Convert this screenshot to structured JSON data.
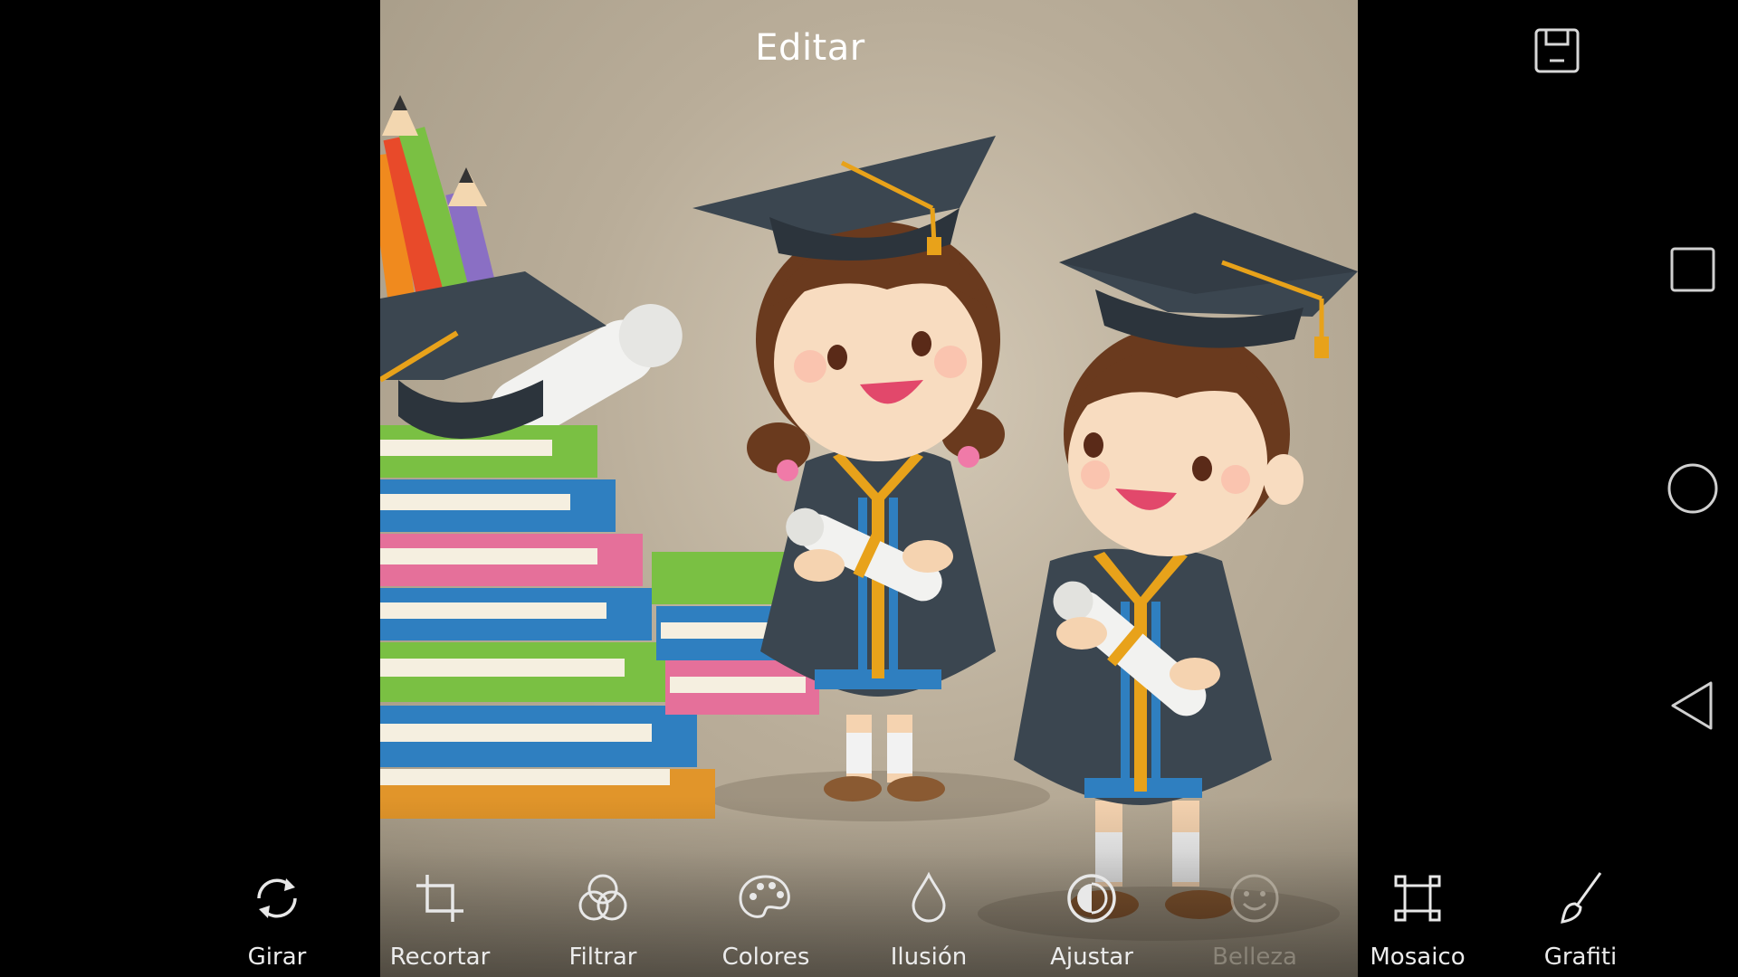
{
  "header": {
    "title": "Editar"
  },
  "icons": {
    "save": "save-icon",
    "recent": "square-recent-icon",
    "home": "circle-home-icon",
    "back": "triangle-back-icon"
  },
  "image": {
    "description_colors": {
      "background": "#b9ad99",
      "gown": "#3b4650",
      "gold": "#e8a21a",
      "blue": "#2f7fc0"
    }
  },
  "toolbar": {
    "tools": [
      {
        "label": "Girar",
        "icon": "rotate-icon",
        "enabled": true
      },
      {
        "label": "Recortar",
        "icon": "crop-icon",
        "enabled": true
      },
      {
        "label": "Filtrar",
        "icon": "filter-icon",
        "enabled": true
      },
      {
        "label": "Colores",
        "icon": "palette-icon",
        "enabled": true
      },
      {
        "label": "Ilusión",
        "icon": "drop-icon",
        "enabled": true
      },
      {
        "label": "Ajustar",
        "icon": "contrast-icon",
        "enabled": true
      },
      {
        "label": "Belleza",
        "icon": "smile-icon",
        "enabled": false
      },
      {
        "label": "Mosaico",
        "icon": "mosaic-icon",
        "enabled": true
      },
      {
        "label": "Grafiti",
        "icon": "brush-icon",
        "enabled": true
      }
    ]
  }
}
